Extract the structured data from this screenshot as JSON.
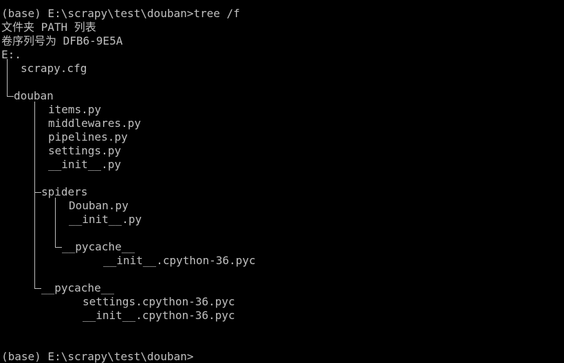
{
  "colors": {
    "background": "#000000",
    "text": "#c0c0c0"
  },
  "prompt_command": "(base) E:\\scrapy\\test\\douban>tree /f",
  "header": {
    "folder_list": "文件夹 PATH 列表",
    "serial": "卷序列号为 DFB6-9E5A",
    "root": "E:."
  },
  "tree": {
    "root_file": "scrapy.cfg",
    "douban_dir": "douban",
    "douban_files": [
      "items.py",
      "middlewares.py",
      "pipelines.py",
      "settings.py",
      "__init__.py"
    ],
    "spiders_dir": "spiders",
    "spiders_files": [
      "Douban.py",
      "__init__.py"
    ],
    "spiders_pycache_dir": "__pycache__",
    "spiders_pycache_files": [
      "__init__.cpython-36.pyc"
    ],
    "douban_pycache_dir": "__pycache__",
    "douban_pycache_files": [
      "settings.cpython-36.pyc",
      "__init__.cpython-36.pyc"
    ]
  },
  "prompt_final": "(base) E:\\scrapy\\test\\douban>"
}
